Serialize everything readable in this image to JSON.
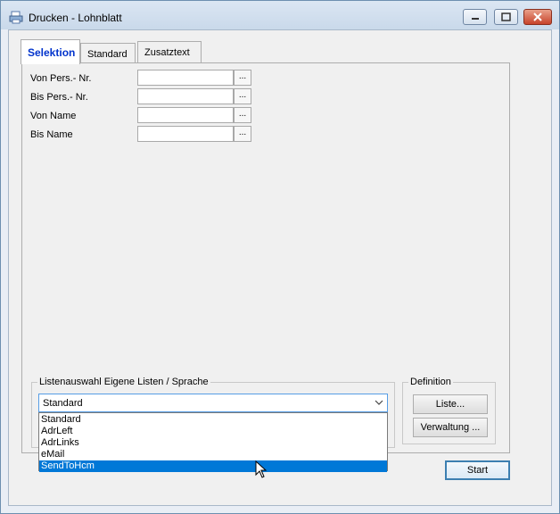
{
  "window": {
    "title": "Drucken - Lohnblatt",
    "controls": {
      "minimize": "minimize-icon",
      "maximize": "maximize-icon",
      "close": "close-icon"
    }
  },
  "tabs": [
    {
      "label": "Selektion",
      "active": true
    },
    {
      "label": "Standard",
      "active": false
    },
    {
      "label": "Zusatztext",
      "active": false
    }
  ],
  "selection": {
    "rows": [
      {
        "label": "Von Pers.- Nr.",
        "value": "",
        "browse": "..."
      },
      {
        "label": "Bis Pers.- Nr.",
        "value": "",
        "browse": "..."
      },
      {
        "label": "Von Name",
        "value": "",
        "browse": "..."
      },
      {
        "label": "Bis Name",
        "value": "",
        "browse": "..."
      }
    ]
  },
  "list_group": {
    "title": "Listenauswahl Eigene Listen / Sprache",
    "selected": "Standard",
    "options": [
      "Standard",
      "AdrLeft",
      "AdrLinks",
      "eMail",
      "SendToHcm"
    ],
    "highlighted": "SendToHcm"
  },
  "definition_group": {
    "title": "Definition",
    "liste_button": "Liste...",
    "verwaltung_button": "Verwaltung ..."
  },
  "footer": {
    "start_button": "Start"
  },
  "colors": {
    "accent": "#0078d7",
    "tab_active_text": "#0033cc",
    "close_button": "#c7432a"
  }
}
